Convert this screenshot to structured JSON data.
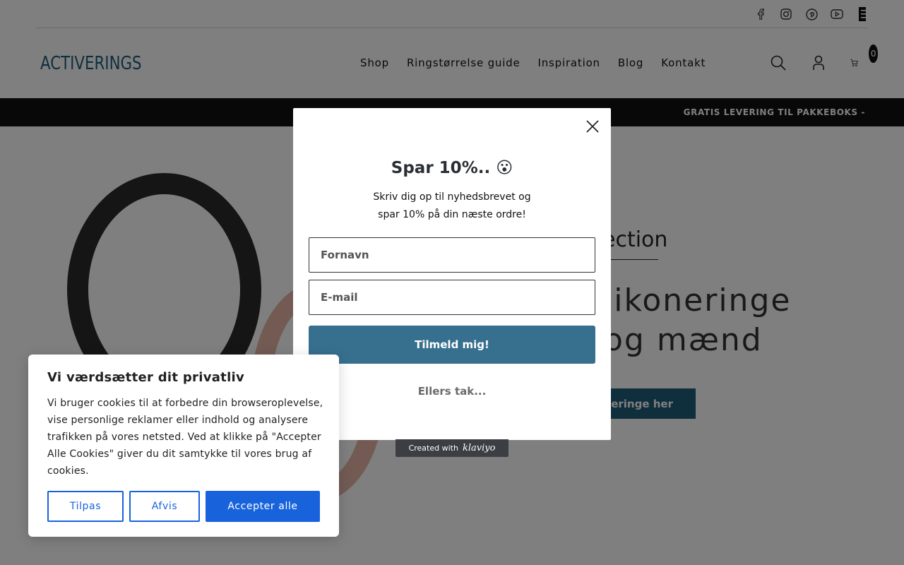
{
  "social": {
    "icons": [
      "facebook-icon",
      "instagram-icon",
      "pinterest-icon",
      "youtube-icon",
      "menu-icon"
    ]
  },
  "header": {
    "logo": "ACTIVERINGS",
    "nav": [
      "Shop",
      "Ringstørrelse guide",
      "Inspiration",
      "Blog",
      "Kontakt"
    ],
    "cart_count": "0"
  },
  "announcement": "GRATIS LEVERING TIL PAKKEBOKS -",
  "hero": {
    "kicker_fragment": "ection",
    "title_line1": "likoneringe",
    "title_line2": "og mænd",
    "button_fragment": "eringe her"
  },
  "popup": {
    "title": "Spar 10%.. 😮",
    "subtitle_line1": "Skriv dig op til nyhedsbrevet og",
    "subtitle_line2": "spar 10% på din næste ordre!",
    "firstname_placeholder": "Fornavn",
    "email_placeholder": "E-mail",
    "submit_label": "Tilmeld mig!",
    "decline_label": "Ellers tak...",
    "created_with": "Created with",
    "brand": "klaviyo"
  },
  "cookie": {
    "title": "Vi værdsætter dit privatliv",
    "text": "Vi bruger cookies til at forbedre din browseroplevelse, vise personlige reklamer eller indhold og analysere trafikken på vores netsted. Ved at klikke på \"Accepter Alle Cookies\" giver du dit samtykke til vores brug af cookies.",
    "customize_label": "Tilpas",
    "reject_label": "Afvis",
    "accept_label": "Accepter alle"
  },
  "colors": {
    "brand": "#1e5e7a",
    "popup_button": "#376f8f",
    "cookie_accent": "#1863dc",
    "announce_bg": "#111111"
  }
}
